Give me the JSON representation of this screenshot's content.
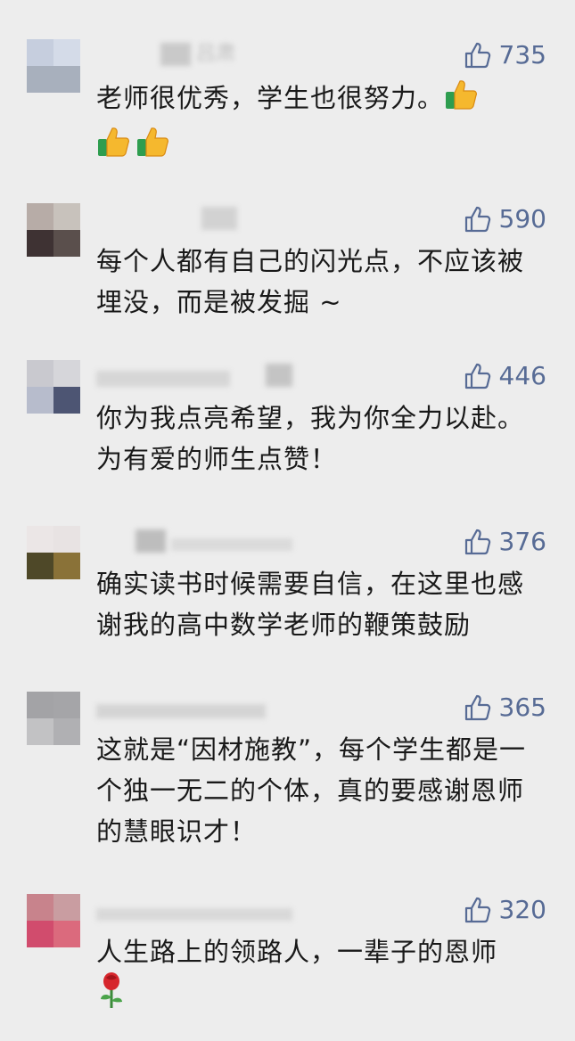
{
  "comments": [
    {
      "name": "吕肃",
      "likes": "735",
      "text": "老师很优秀，学生也很努力。",
      "avatar": [
        "#c6cede",
        "#d4dbe8",
        "#a8b0bd",
        "#a8b0bd"
      ],
      "emoji": [
        "thumbs-up",
        "thumbs-up",
        "thumbs-up"
      ]
    },
    {
      "name": "",
      "likes": "590",
      "text": "每个人都有自己的闪光点，不应该被埋没，而是被发掘 ~",
      "avatar": [
        "#b7aca7",
        "#c8c2bc",
        "#3e3233",
        "#5a4f4c"
      ],
      "emoji": []
    },
    {
      "name": "",
      "likes": "446",
      "text": "你为我点亮希望，我为你全力以赴。为有爱的师生点赞！",
      "avatar": [
        "#c9c9cf",
        "#d6d6da",
        "#b7bccc",
        "#4d5573"
      ],
      "emoji": []
    },
    {
      "name": "",
      "likes": "376",
      "text": "确实读书时候需要自信，在这里也感谢我的高中数学老师的鞭策鼓励",
      "avatar": [
        "#ebe6e6",
        "#e8e3e3",
        "#4e4828",
        "#8a7238"
      ],
      "emoji": []
    },
    {
      "name": "",
      "likes": "365",
      "text": "这就是“因材施教”，每个学生都是一个独一无二的个体，真的要感谢恩师的慧眼识才！",
      "avatar": [
        "#a3a3a6",
        "#a5a5a8",
        "#c2c2c4",
        "#b0b0b3"
      ],
      "emoji": []
    },
    {
      "name": "",
      "likes": "320",
      "text": "人生路上的领路人，一辈子的恩师",
      "avatar": [
        "#c8838c",
        "#c99da1",
        "#d14c6d",
        "#db6a7d"
      ],
      "emoji": [
        "rose"
      ]
    }
  ]
}
